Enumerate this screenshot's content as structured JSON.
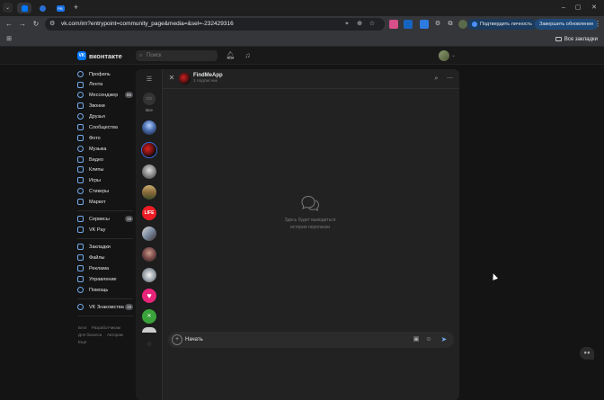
{
  "browser": {
    "url": "vk.com/im?entrypoint=community_page&media=&sel=-232429316",
    "tabs": [
      {
        "label": "",
        "icon": "vk-tab-icon",
        "active": true
      },
      {
        "label": "",
        "icon": "cloud-tab-icon",
        "active": false
      },
      {
        "label": "PB",
        "icon": "pb-tab-icon",
        "active": false
      }
    ],
    "confirm_identity": "Подтвердить личность",
    "finish_update": "Завершить обновление",
    "all_bookmarks": "Все закладки"
  },
  "vk": {
    "logo": "вконтакте",
    "logo_mark": "VK",
    "search_placeholder": "Поиск",
    "sidebar": {
      "items": [
        {
          "label": "Профиль"
        },
        {
          "label": "Лента"
        },
        {
          "label": "Мессенджер",
          "badge": "86"
        },
        {
          "label": "Звонки"
        },
        {
          "label": "Друзья"
        },
        {
          "label": "Сообщества"
        },
        {
          "label": "Фото"
        },
        {
          "label": "Музыка"
        },
        {
          "label": "Видео"
        },
        {
          "label": "Клипы"
        },
        {
          "label": "Игры"
        },
        {
          "label": "Стикеры"
        },
        {
          "label": "Маркет"
        },
        {
          "label": "Сервисы",
          "badge": "19"
        },
        {
          "label": "VK Pay"
        },
        {
          "label": "Закладки"
        },
        {
          "label": "Файлы"
        },
        {
          "label": "Реклама"
        },
        {
          "label": "Управление"
        },
        {
          "label": "Помощь"
        },
        {
          "label": "VK Знакомства",
          "badge": "19"
        }
      ],
      "footer": [
        "Блог",
        "Разработчикам",
        "Для бизнеса",
        "Авторам",
        "Ещё"
      ]
    },
    "messenger": {
      "all_label": "Все",
      "life_label": "LIFE",
      "chat_title": "FindMeApp",
      "chat_subtitle": "1 подписчик",
      "empty_line1": "Здесь будет выводиться",
      "empty_line2": "история переписки",
      "composer_value": "Начать"
    }
  },
  "colors": {
    "accent": "#71aaeb",
    "vk_blue": "#0077ff",
    "background": "#141414",
    "panel": "#222222"
  }
}
